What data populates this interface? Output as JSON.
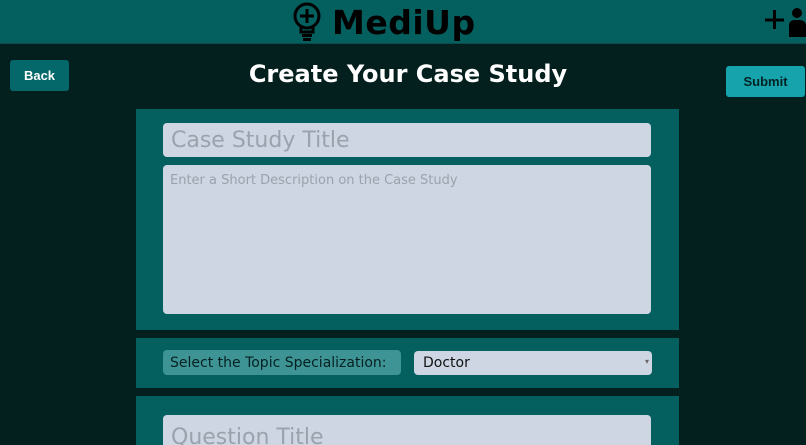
{
  "header": {
    "brand_name": "MediUp",
    "brand_icon": "lightbulb-plus-icon",
    "add_user_icon": "add-user-icon"
  },
  "page": {
    "title": "Create Your Case Study",
    "back_label": "Back",
    "submit_label": "Submit"
  },
  "form": {
    "title_placeholder": "Case Study Title",
    "title_value": "",
    "description_placeholder": "Enter a Short Description on the Case Study",
    "description_value": "",
    "topic_label": "Select the Topic Specialization:",
    "topic_selected": "Doctor",
    "question_placeholder": "Question Title",
    "question_value": ""
  },
  "colors": {
    "header_bg": "#045f5f",
    "page_bg": "#03201f",
    "panel_bg": "#045f5f",
    "field_bg": "#cdd6e2",
    "submit_bg": "#16a3ab",
    "back_bg": "#04686a"
  }
}
